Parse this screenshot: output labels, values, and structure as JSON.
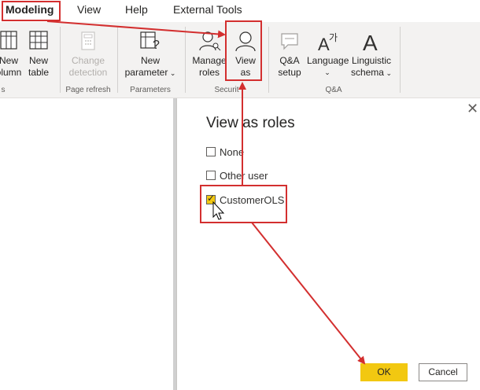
{
  "menu": {
    "items": [
      "Modeling",
      "View",
      "Help",
      "External Tools"
    ]
  },
  "ribbon": {
    "buttons": {
      "new_column": [
        "New",
        "olumn"
      ],
      "new_table": [
        "New",
        "table"
      ],
      "change_detection": [
        "Change",
        "detection"
      ],
      "new_parameter": [
        "New",
        "parameter"
      ],
      "manage_roles": [
        "Manage",
        "roles"
      ],
      "view_as": [
        "View",
        "as"
      ],
      "qa_setup": [
        "Q&A",
        "setup"
      ],
      "language": [
        "Language",
        ""
      ],
      "linguistic_schema": [
        "Linguistic",
        "schema"
      ]
    },
    "groups": {
      "calculations": "s",
      "page_refresh": "Page refresh",
      "parameters": "Parameters",
      "security": "Securit",
      "qa": "Q&A"
    }
  },
  "dialog": {
    "title": "View as roles",
    "options": [
      {
        "label": "None",
        "checked": false
      },
      {
        "label": "Other user",
        "checked": false
      },
      {
        "label": "CustomerOLS",
        "checked": true
      }
    ],
    "ok_label": "OK",
    "cancel_label": "Cancel",
    "close_glyph": "✕"
  },
  "colors": {
    "annotation": "#d32f2f",
    "accent": "#f2c811"
  }
}
